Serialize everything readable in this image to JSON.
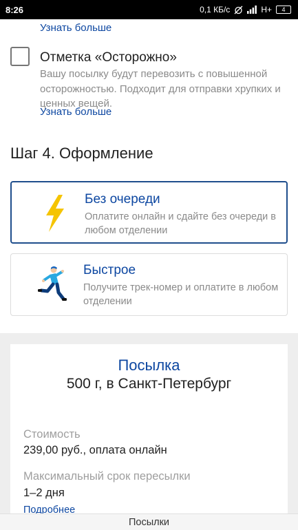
{
  "status_bar": {
    "time": "8:26",
    "speed": "0,1 КБ/с",
    "network": "H+",
    "battery": "4"
  },
  "options": {
    "top_link": "Узнать больше",
    "careful": {
      "title": "Отметка «Осторожно»",
      "description": "Вашу посылку будут перевозить с повышенной осторожностью. Подходит для отправки хрупких и ценных вещей.",
      "link": "Узнать больше",
      "checked": false
    }
  },
  "step4": {
    "title": "Шаг 4. Оформление",
    "cards": [
      {
        "title": "Без очереди",
        "description": "Оплатите онлайн и сдайте без очереди в любом отделении",
        "icon": "lightning-icon",
        "selected": true
      },
      {
        "title": "Быстрое",
        "description": "Получите трек-номер и оплатите в любом отделении",
        "icon": "runner-icon",
        "selected": false
      }
    ]
  },
  "summary": {
    "title": "Посылка",
    "subtitle": "500 г, в Санкт-Петербург",
    "cost_label": "Стоимость",
    "cost_value": "239,00 руб., оплата онлайн",
    "term_label": "Максимальный срок пересылки",
    "term_value": "1–2 дня",
    "details_link": "Подробнее"
  },
  "bottom_bar": {
    "label": "Посылки"
  },
  "colors": {
    "accent_blue": "#0d47a1",
    "selected_border": "#1e4d8c",
    "lightning_yellow": "#f5c400",
    "muted_text": "#8a8a8a"
  }
}
